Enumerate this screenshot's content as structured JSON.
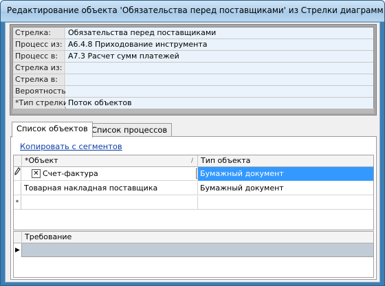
{
  "window": {
    "title": "Редактирование объекта 'Обязательства перед поставщиками' из Стрелки диаграмм"
  },
  "properties": [
    {
      "label": "Стрелка:",
      "value": "Обязательства перед поставщиками"
    },
    {
      "label": "Процесс из:",
      "value": "А6.4.8 Приходование инструмента"
    },
    {
      "label": "Процесс в:",
      "value": "А7.3 Расчет сумм платежей"
    },
    {
      "label": "Стрелка из:",
      "value": ""
    },
    {
      "label": "Стрелка в:",
      "value": ""
    },
    {
      "label": "Вероятность:",
      "value": ""
    },
    {
      "label": "*Тип стрелки:",
      "value": "Поток объектов"
    }
  ],
  "tabs": [
    {
      "label": "Список объектов",
      "active": true
    },
    {
      "label": "Список процессов",
      "active": false
    }
  ],
  "copy_link": "Копировать с сегментов",
  "objects_grid": {
    "columns": [
      "*Объект",
      "Тип объекта"
    ],
    "rows": [
      {
        "indicator": "pencil",
        "object": "Счет-фактура",
        "type": "Бумажный документ",
        "editing": true
      },
      {
        "indicator": "",
        "object": "Товарная накладная поставщика",
        "type": "Бумажный документ",
        "editing": false
      }
    ],
    "new_row_indicator": "*"
  },
  "requirements_grid": {
    "column": "Требование",
    "current_indicator": "▶"
  },
  "colors": {
    "title_bar": "#b6d4ee",
    "selection": "#3399ff",
    "link": "#0c3ea8"
  }
}
